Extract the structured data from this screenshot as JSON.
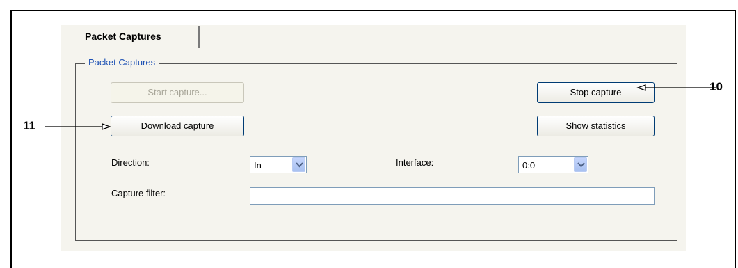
{
  "tab": {
    "label": "Packet Captures"
  },
  "group": {
    "title": "Packet Captures"
  },
  "buttons": {
    "start": "Start capture...",
    "stop": "Stop capture",
    "download": "Download capture",
    "statistics": "Show statistics"
  },
  "fields": {
    "direction": {
      "label": "Direction:",
      "value": "In"
    },
    "interface": {
      "label": "Interface:",
      "value": "0:0"
    },
    "capture_filter": {
      "label": "Capture filter:",
      "value": ""
    }
  },
  "callouts": {
    "stop": "10",
    "download": "11"
  }
}
